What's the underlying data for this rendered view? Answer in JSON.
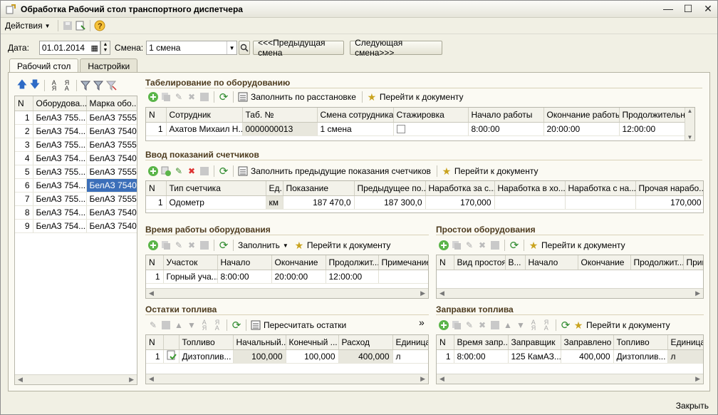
{
  "window": {
    "title": "Обработка  Рабочий стол транспортного диспетчера"
  },
  "menu": {
    "actions": "Действия"
  },
  "filter": {
    "date_label": "Дата:",
    "date_value": "01.01.2014",
    "shift_label": "Смена:",
    "shift_value": "1 смена",
    "prev_shift": "<<<Предыдущая смена",
    "next_shift": "Следующая смена>>>"
  },
  "tabs": [
    {
      "label": "Рабочий стол"
    },
    {
      "label": "Настройки"
    }
  ],
  "equipment": {
    "columns": [
      "N",
      "Оборудова...",
      "Марка обо..."
    ],
    "rows": [
      [
        "1",
        "БелАЗ 755...",
        "БелАЗ 7555"
      ],
      [
        "2",
        "БелАЗ 754...",
        "БелАЗ 7540"
      ],
      [
        "3",
        "БелАЗ 755...",
        "БелАЗ 7555"
      ],
      [
        "4",
        "БелАЗ 754...",
        "БелАЗ 7540"
      ],
      [
        "5",
        "БелАЗ 755...",
        "БелАЗ 7555"
      ],
      [
        "6",
        "БелАЗ 754...",
        "БелАЗ 7540"
      ],
      [
        "7",
        "БелАЗ 755...",
        "БелАЗ 7555"
      ],
      [
        "8",
        "БелАЗ 754...",
        "БелАЗ 7540"
      ],
      [
        "9",
        "БелАЗ 754...",
        "БелАЗ 7540"
      ]
    ]
  },
  "timesheet": {
    "title": "Табелирование по оборудованию",
    "fill_btn": "Заполнить по расстановке",
    "goto_btn": "Перейти к документу",
    "columns": [
      "N",
      "Сотрудник",
      "Таб. №",
      "Смена сотрудника",
      "Стажировка",
      "Начало работы",
      "Окончание работы",
      "Продолжительн..."
    ],
    "rows": [
      [
        "1",
        "Ахатов Михаил Н...",
        "0000000013",
        "1 смена",
        "",
        "8:00:00",
        "20:00:00",
        "12:00:00"
      ]
    ]
  },
  "meters": {
    "title": "Ввод показаний счетчиков",
    "fill_btn": "Заполнить предыдущие показания счетчиков",
    "goto_btn": "Перейти к документу",
    "columns": [
      "N",
      "Тип счетчика",
      "Ед.",
      "Показание",
      "Предыдущее по...",
      "Наработка за с...",
      "Наработка в хо...",
      "Наработка с на...",
      "Прочая нарабо..."
    ],
    "rows": [
      [
        "1",
        "Одометр",
        "км",
        "187 470,0",
        "187 300,0",
        "170,000",
        "",
        "",
        "170,000"
      ]
    ]
  },
  "worktime": {
    "title": "Время работы оборудования",
    "fill_btn": "Заполнить",
    "goto_btn": "Перейти к документу",
    "columns": [
      "N",
      "Участок",
      "Начало",
      "Окончание",
      "Продолжит...",
      "Примечание"
    ],
    "rows": [
      [
        "1",
        "Горный уча...",
        "8:00:00",
        "20:00:00",
        "12:00:00",
        ""
      ]
    ]
  },
  "downtime": {
    "title": "Простои оборудования",
    "goto_btn": "Перейти к документу",
    "columns": [
      "N",
      "Вид простоя",
      "В...",
      "Начало",
      "Окончание",
      "Продолжит...",
      "Прим"
    ]
  },
  "fuel_rest": {
    "title": "Остатки топлива",
    "recalc_btn": "Пересчитать остатки",
    "more": "»",
    "columns": [
      "N",
      "",
      "Топливо",
      "Начальный...",
      "Конечный ...",
      "Расход",
      "Единица"
    ],
    "rows": [
      [
        "1",
        "",
        "Дизтоплив...",
        "100,000",
        "100,000",
        "400,000",
        "л"
      ]
    ]
  },
  "fuel_refill": {
    "title": "Заправки топлива",
    "goto_btn": "Перейти к документу",
    "columns": [
      "N",
      "Время запр...",
      "Заправщик",
      "Заправлено",
      "Топливо",
      "Единица и"
    ],
    "rows": [
      [
        "1",
        "8:00:00",
        "125 КамАЗ...",
        "400,000",
        "Дизтоплив...",
        "л"
      ]
    ]
  },
  "footer": {
    "close": "Закрыть"
  }
}
